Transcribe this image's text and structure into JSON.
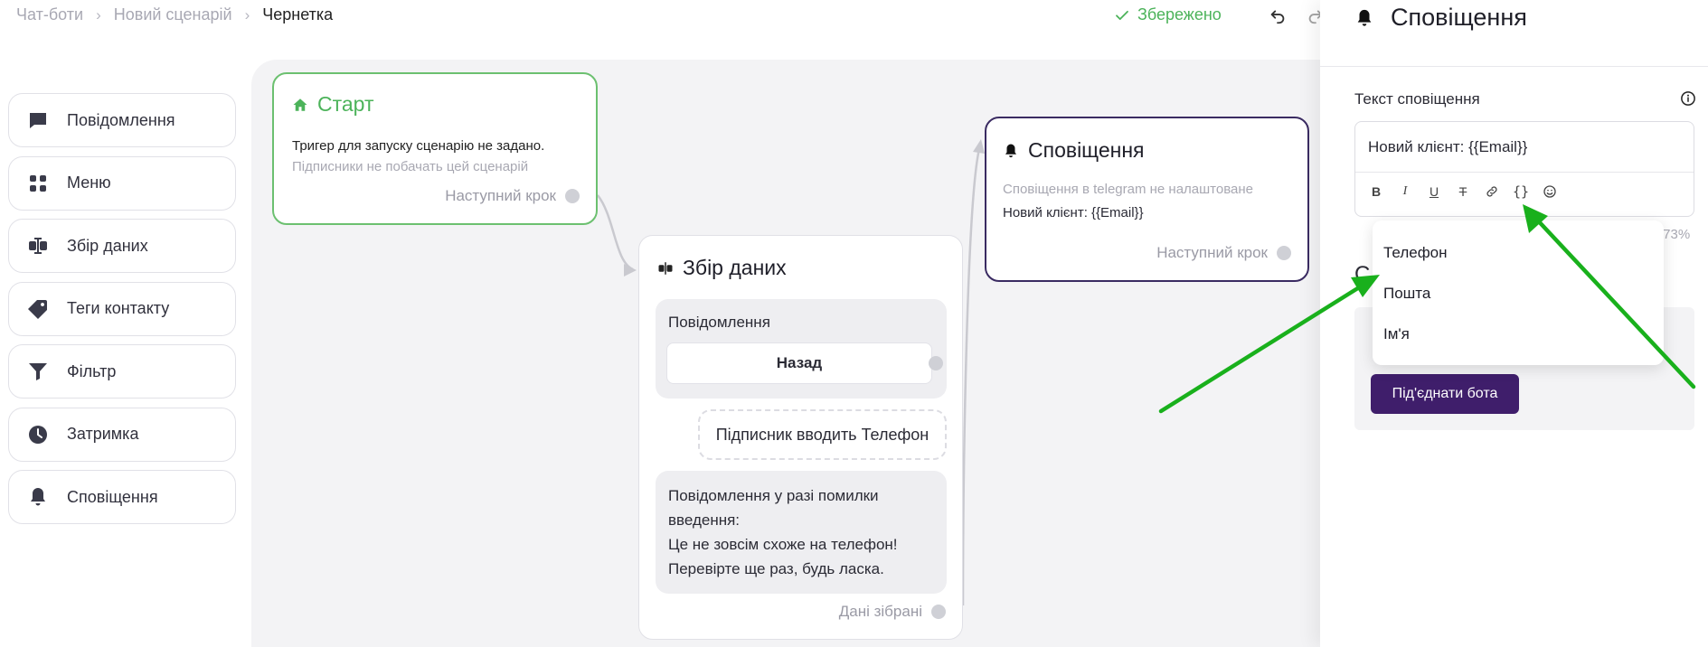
{
  "breadcrumb": [
    "Чат-боти",
    "Новий сценарій",
    "Чернетка"
  ],
  "status": {
    "saved_label": "Збережено",
    "color": "#4cb35a"
  },
  "palette": [
    {
      "label": "Повідомлення",
      "icon": "chat-bubble-icon"
    },
    {
      "label": "Меню",
      "icon": "grid-icon"
    },
    {
      "label": "Збір даних",
      "icon": "input-cursor-icon"
    },
    {
      "label": "Теги контакту",
      "icon": "tag-icon"
    },
    {
      "label": "Фільтр",
      "icon": "funnel-icon"
    },
    {
      "label": "Затримка",
      "icon": "clock-icon"
    },
    {
      "label": "Сповіщення",
      "icon": "bell-icon"
    }
  ],
  "nodes": {
    "start": {
      "title": "Старт",
      "desc": "Тригер для запуску сценарію не задано.",
      "hint": "Підписники не побачать цей сценарій",
      "next": "Наступний крок"
    },
    "collect": {
      "title": "Збір даних",
      "message_label": "Повідомлення",
      "back_button": "Назад",
      "input_label": "Підписник вводить Телефон",
      "error_lines": [
        "Повідомлення у разі помилки",
        "введення:",
        "Це не зовсім схоже на телефон!",
        "Перевірте ще раз, будь ласка."
      ],
      "next": "Дані зібрані"
    },
    "notify": {
      "title": "Сповіщення",
      "warning": "Сповіщення в telegram не налаштоване",
      "text": "Новий клієнт: {{Email}}",
      "next": "Наступний крок"
    }
  },
  "panel": {
    "title": "Сповіщення",
    "field_label": "Текст сповіщення",
    "editor_value": "Новий клієнт: {{Email}}",
    "toolbar": [
      "B",
      "I",
      "U",
      "S",
      "link",
      "{}",
      "emoji"
    ],
    "percent": ".73%",
    "partial_heading": "С",
    "connect_button": "Під'єднати бота"
  },
  "dropdown": [
    "Телефон",
    "Пошта",
    "Ім'я"
  ],
  "colors": {
    "accent": "#3f1e6b",
    "start_border": "#6cc070",
    "annotation_arrow": "#19b01c"
  }
}
